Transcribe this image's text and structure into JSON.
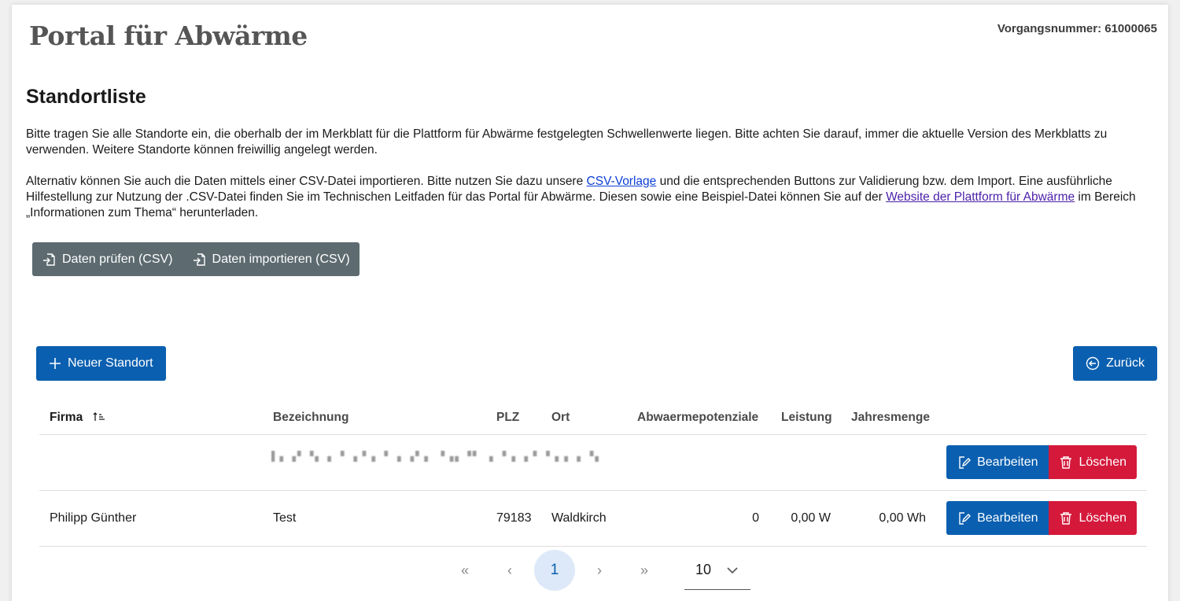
{
  "header": {
    "portal_title": "Portal für Abwärme",
    "vorgangsnummer": "Vorgangsnummer: 61000065"
  },
  "section": {
    "title": "Standortliste",
    "para1": "Bitte tragen Sie alle Standorte ein, die oberhalb der im Merkblatt für die Plattform für Abwärme festgelegten Schwellenwerte liegen. Bitte achten Sie darauf, immer die aktuelle Version des Merkblatts zu verwenden. Weitere Standorte können freiwillig angelegt werden.",
    "para2_a": "Alternativ können Sie auch die Daten mittels einer CSV-Datei importieren. Bitte nutzen Sie dazu unsere ",
    "para2_link1": "CSV-Vorlage",
    "para2_b": " und die entsprechenden Buttons zur Validierung bzw. dem Import. Eine ausführliche Hilfestellung zur Nutzung der .CSV-Datei finden Sie im Technischen Leitfaden für das Portal für Abwärme. Diesen sowie eine Beispiel-Datei können Sie auf der ",
    "para2_link2": "Website der Plattform für Abwärme",
    "para2_c": " im Bereich „Informationen zum Thema“ herunterladen."
  },
  "csv": {
    "check_label": "Daten prüfen (CSV)",
    "import_label": "Daten importieren (CSV)"
  },
  "actions": {
    "new_label": "Neuer Standort",
    "back_label": "Zurück"
  },
  "table": {
    "headers": {
      "firma": "Firma",
      "bezeichnung": "Bezeichnung",
      "plz": "PLZ",
      "ort": "Ort",
      "abwaerme": "Abwaermepotenziale",
      "leistung": "Leistung",
      "jahresmenge": "Jahresmenge"
    },
    "edit_label": "Bearbeiten",
    "delete_label": "Löschen",
    "rows": [
      {
        "firma": "",
        "bezeichnung": "",
        "plz": "",
        "ort": "",
        "abwaerme": "",
        "leistung": "",
        "jahresmenge": ""
      },
      {
        "firma": "Philipp Günther",
        "bezeichnung": "Test",
        "plz": "79183",
        "ort": "Waldkirch",
        "abwaerme": "0",
        "leistung": "0,00 W",
        "jahresmenge": "0,00 Wh"
      }
    ]
  },
  "pager": {
    "first": "«",
    "prev": "‹",
    "current": "1",
    "next": "›",
    "last": "»",
    "page_size": "10"
  },
  "icons": {
    "import": "file-import-icon",
    "plus": "plus-icon",
    "back": "arrow-left-circle-icon",
    "edit": "edit-icon",
    "delete": "trash-icon",
    "sort": "sort-asc-icon",
    "chevron": "chevron-down-icon"
  },
  "colors": {
    "primary": "#0a5fb0",
    "danger": "#d4193b",
    "csv_group": "#5d6b70"
  }
}
